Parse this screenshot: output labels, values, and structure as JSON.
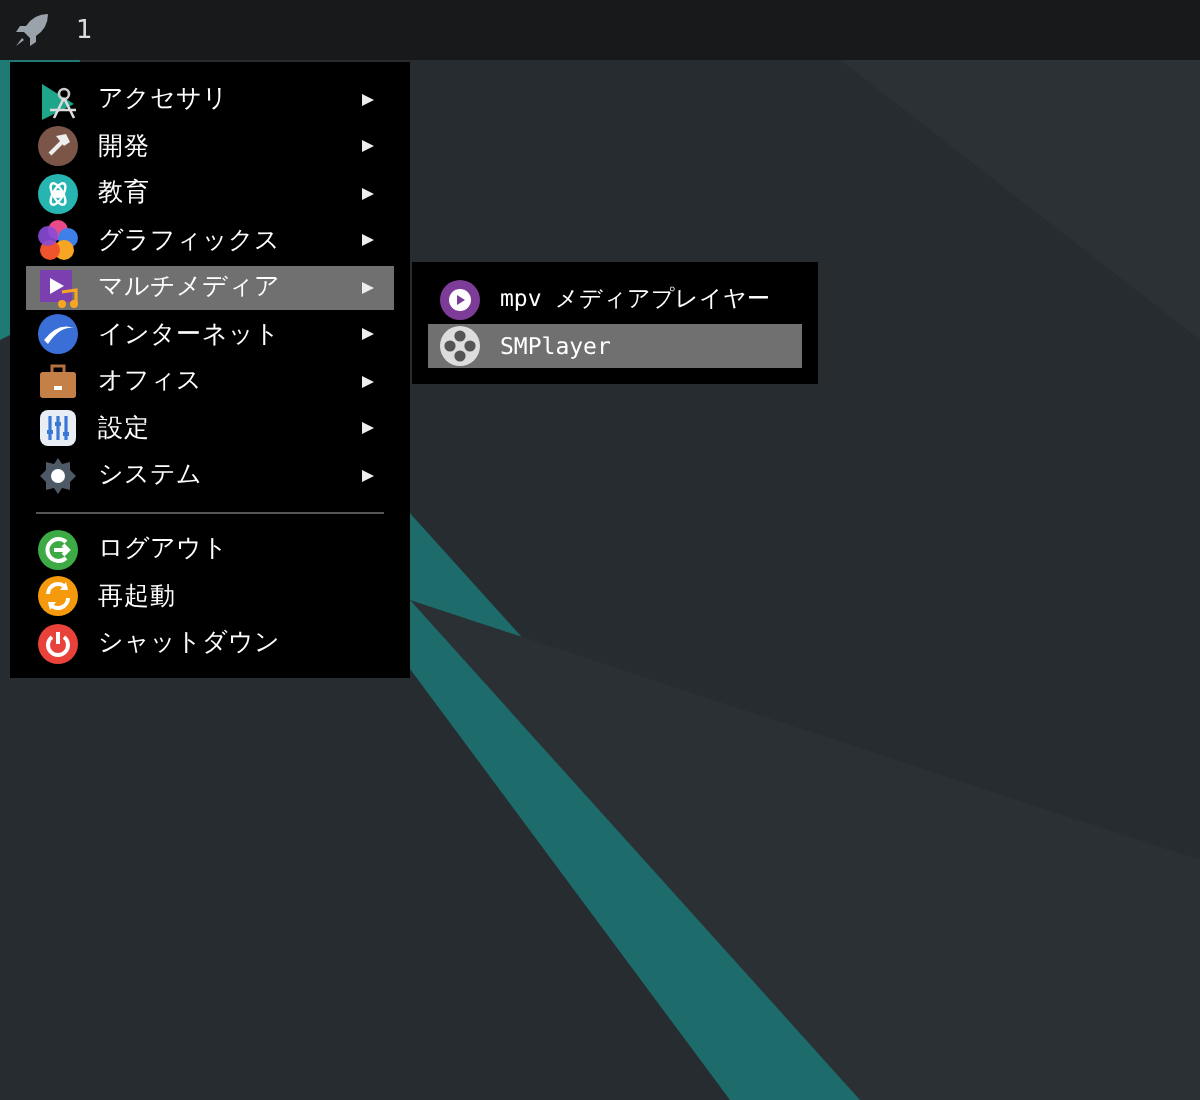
{
  "taskbar": {
    "workspace": "1"
  },
  "menu": {
    "categories": [
      {
        "label": "アクセサリ",
        "has_submenu": true,
        "selected": false
      },
      {
        "label": "開発",
        "has_submenu": true,
        "selected": false
      },
      {
        "label": "教育",
        "has_submenu": true,
        "selected": false
      },
      {
        "label": "グラフィックス",
        "has_submenu": true,
        "selected": false
      },
      {
        "label": "マルチメディア",
        "has_submenu": true,
        "selected": true
      },
      {
        "label": "インターネット",
        "has_submenu": true,
        "selected": false
      },
      {
        "label": "オフィス",
        "has_submenu": true,
        "selected": false
      },
      {
        "label": "設定",
        "has_submenu": true,
        "selected": false
      },
      {
        "label": "システム",
        "has_submenu": true,
        "selected": false
      }
    ],
    "actions": [
      {
        "label": "ログアウト",
        "selected": false
      },
      {
        "label": "再起動",
        "selected": false
      },
      {
        "label": "シャットダウン",
        "selected": false
      }
    ]
  },
  "submenu": {
    "items": [
      {
        "label": "mpv メディアプレイヤー",
        "selected": false
      },
      {
        "label": "SMPlayer",
        "selected": true
      }
    ]
  }
}
